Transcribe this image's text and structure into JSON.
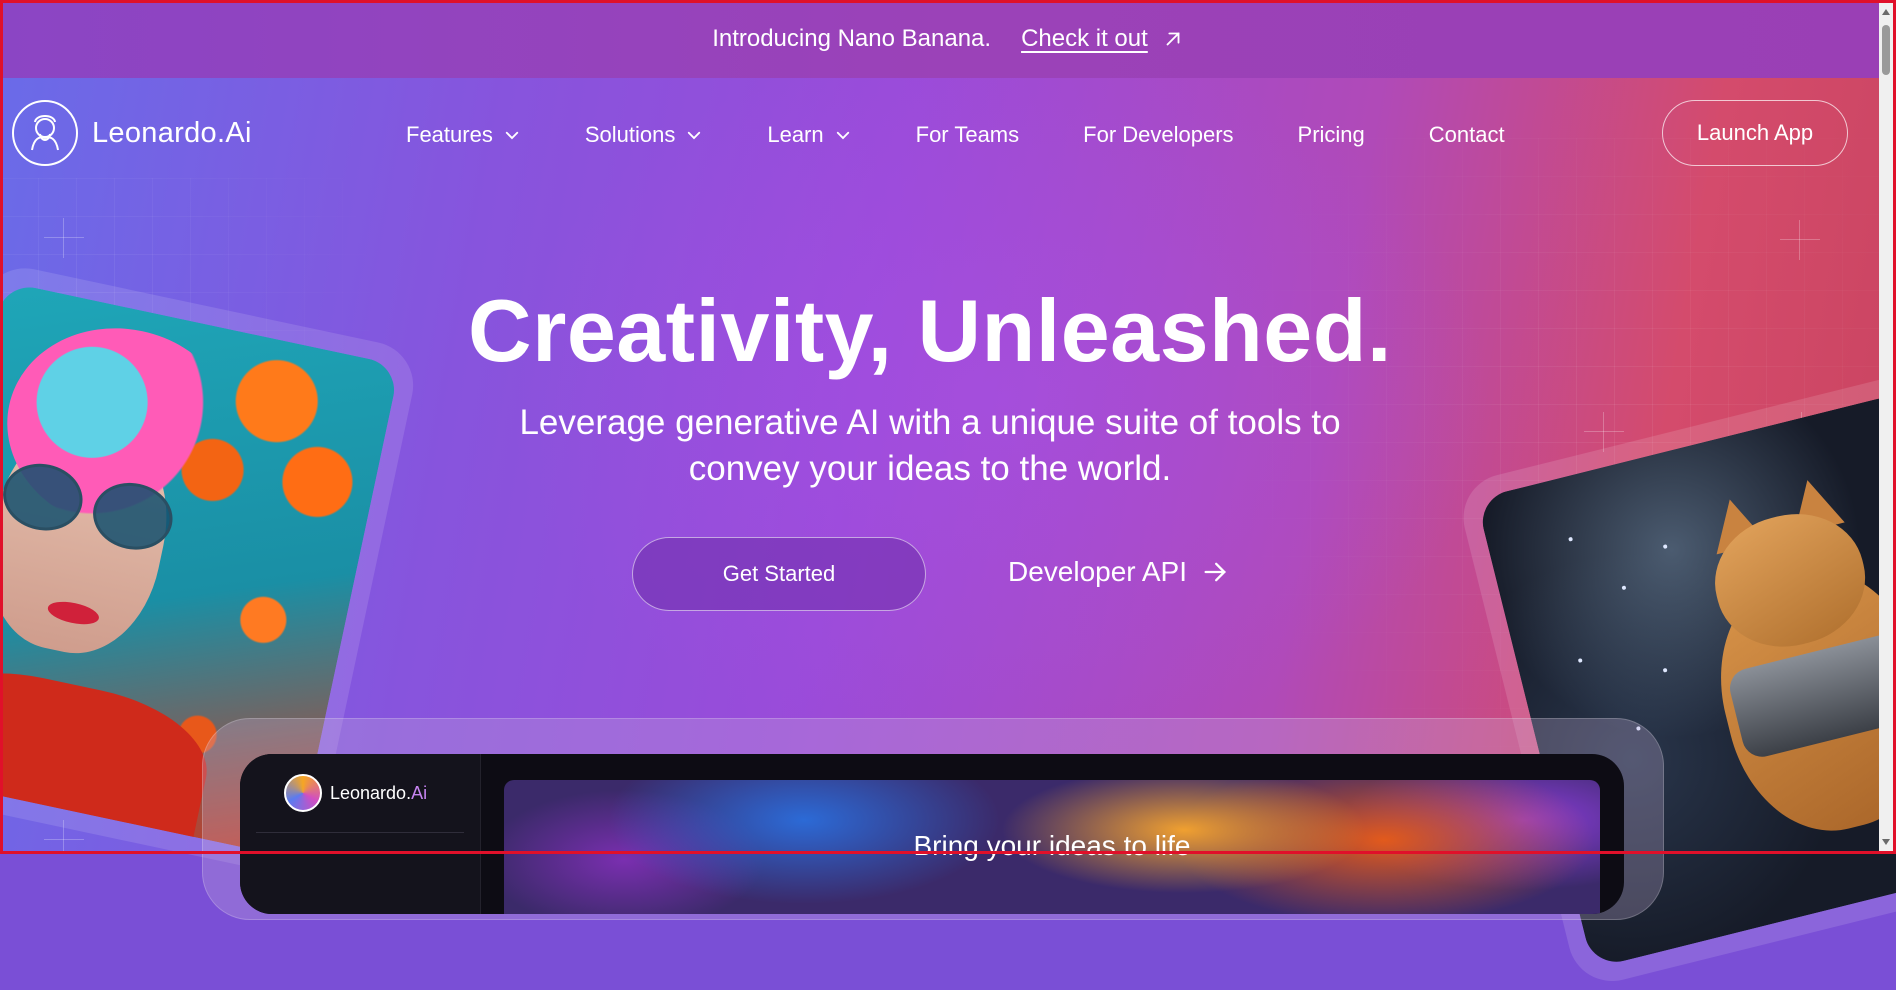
{
  "announcement": {
    "text": "Introducing Nano Banana.",
    "link_label": "Check it out",
    "link_icon": "arrow-up-right-icon"
  },
  "nav": {
    "brand": "Leonardo.Ai",
    "items": [
      {
        "label": "Features",
        "has_dropdown": true
      },
      {
        "label": "Solutions",
        "has_dropdown": true
      },
      {
        "label": "Learn",
        "has_dropdown": true
      },
      {
        "label": "For Teams",
        "has_dropdown": false
      },
      {
        "label": "For Developers",
        "has_dropdown": false
      },
      {
        "label": "Pricing",
        "has_dropdown": false
      },
      {
        "label": "Contact",
        "has_dropdown": false
      }
    ],
    "launch_label": "Launch App"
  },
  "hero": {
    "headline": "Creativity, Unleashed.",
    "subline_1": "Leverage generative AI with a unique suite of tools to",
    "subline_2": "convey your ideas to the world.",
    "primary_cta": "Get Started",
    "secondary_cta": "Developer API",
    "secondary_icon": "arrow-right-icon"
  },
  "preview": {
    "brand_main": "Leonardo.",
    "brand_accent": "Ai",
    "banner_title": "Bring your ideas to life"
  },
  "colors": {
    "announce_bg": "#9b42b8",
    "gradient_start": "#6a6be8",
    "gradient_mid": "#9a4bd9",
    "gradient_end": "#d44b6c",
    "accent_ai": "#c684f0"
  }
}
